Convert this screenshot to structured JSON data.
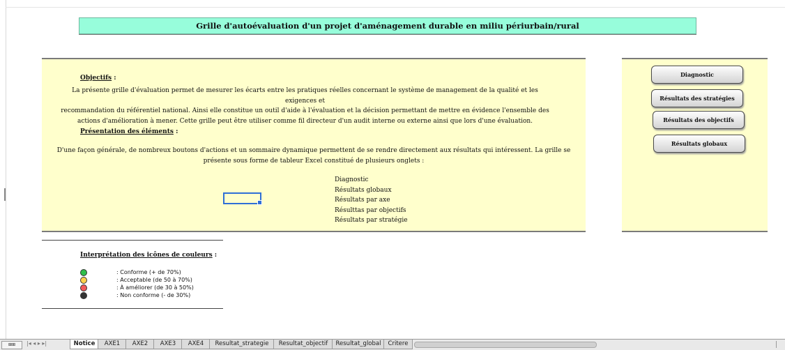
{
  "title": "Grille d'autoévaluation d'un projet d'aménagement durable en miliu périurbain/rural",
  "objectifs": {
    "heading": "Objectifs",
    "colon": " :",
    "lines": [
      "La présente grille d'évaluation permet de mesurer les écarts entre les pratiques réelles concernant le système de management de la qualité et les exigences et",
      "recommandation du référentiel national. Ainsi elle constitue un outil d'aide à l'évaluation et la décision permettant de mettre en évidence l'ensemble des",
      "actions d'amélioration à mener. Cette grille peut être utiliser comme fil directeur d'un audit interne ou externe ainsi que lors d'une évaluation."
    ]
  },
  "presentation": {
    "heading": "Présentation des éléments",
    "colon": " :",
    "lines": [
      "D'une façon générale, de nombreux boutons d'actions et un sommaire dynamique permettent de se rendre directement aux résultats qui intéressent. La grille se",
      "présente sous forme de tableur Excel constitué de plusieurs onglets :"
    ],
    "items": [
      "Diagnostic",
      "Résultats globaux",
      "Résultats par axe",
      "Résulttas par objectifs",
      "Résultats par stratégie"
    ]
  },
  "buttons": [
    "Diagnostic",
    "Résultats des stratégies",
    "Résultats des objectifs",
    "Résultats globaux"
  ],
  "legend": {
    "heading": "Interprétation des icônes de couleurs",
    "colon": " :",
    "items": [
      {
        "label": ": Conforme (+ de 70%)",
        "color": "#2fbf4a"
      },
      {
        "label": ": Acceptable (de 50 à 70%)",
        "color": "#ffd24a"
      },
      {
        "label": ": À améliorer (de 30 à 50%)",
        "color": "#f25a5a"
      },
      {
        "label": ": Non conforme (- de 30%)",
        "color": "#333333"
      }
    ]
  },
  "sheet_tabs": [
    "Notice",
    "AXE1",
    "AXE2",
    "AXE3",
    "AXE4",
    "Resultat_strategie",
    "Resultat_objectif",
    "Resultat_global",
    "Critere"
  ],
  "active_tab": "Notice",
  "status_box": "⊞⊞",
  "nav_arrows": "|◂ ◂ ▸ ▸|"
}
